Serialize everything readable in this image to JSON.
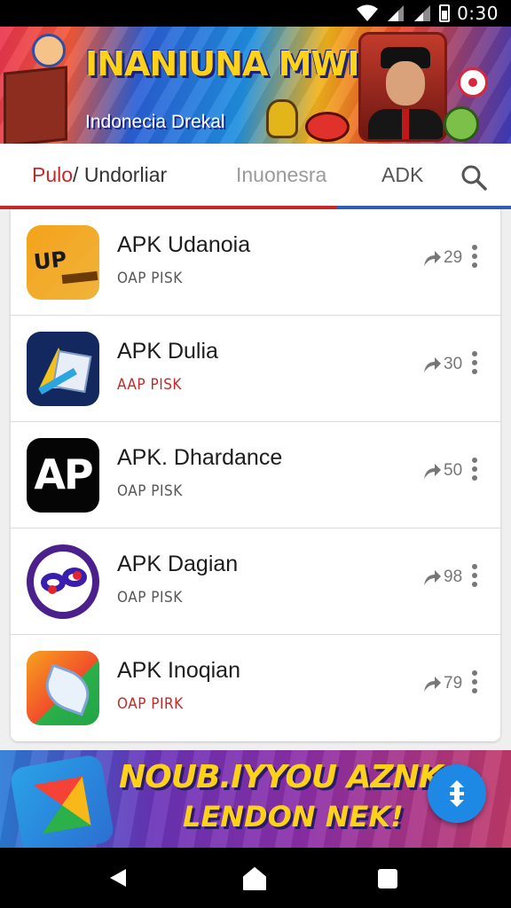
{
  "status_bar": {
    "time": "0:30",
    "icons": [
      "wifi-icon",
      "signal-icon",
      "signal-icon",
      "battery-icon"
    ]
  },
  "top_banner": {
    "title": "INANIUNA MWIIA",
    "subtitle": "Indonecia Drekal"
  },
  "tabs": [
    {
      "label_accent": "Pulo",
      "label_rest": "/ Undorliar",
      "active": true
    },
    {
      "label": "Inuonesra",
      "active": false
    },
    {
      "label": "ADK",
      "active": false
    }
  ],
  "search": {
    "icon": "search-icon"
  },
  "apps": [
    {
      "name": "APK Udanoia",
      "sub": "OAP PISK",
      "count": "29",
      "icon_label": "UP",
      "sub_color": "gray"
    },
    {
      "name": "APK Dulia",
      "sub": "AAP PISK",
      "count": "30",
      "icon_label": "",
      "sub_color": "red"
    },
    {
      "name": "APK. Dhardance",
      "sub": "OAP PISK",
      "count": "50",
      "icon_label": "AP",
      "sub_color": "gray"
    },
    {
      "name": "APK Dagian",
      "sub": "OAP PISK",
      "count": "98",
      "icon_label": "",
      "sub_color": "gray"
    },
    {
      "name": "APK Inoqian",
      "sub": "OAP PIRK",
      "count": "79",
      "icon_label": "",
      "sub_color": "red"
    }
  ],
  "bottom_banner": {
    "line1": "NOUB.IYYOU AZNK",
    "line2": "LENDON NEK!"
  },
  "colors": {
    "accent_red": "#c62828",
    "accent_blue": "#1e88e5",
    "banner_yellow": "#ffd21a"
  },
  "nav": {
    "icons": [
      "back-icon",
      "home-icon",
      "recents-icon"
    ]
  }
}
